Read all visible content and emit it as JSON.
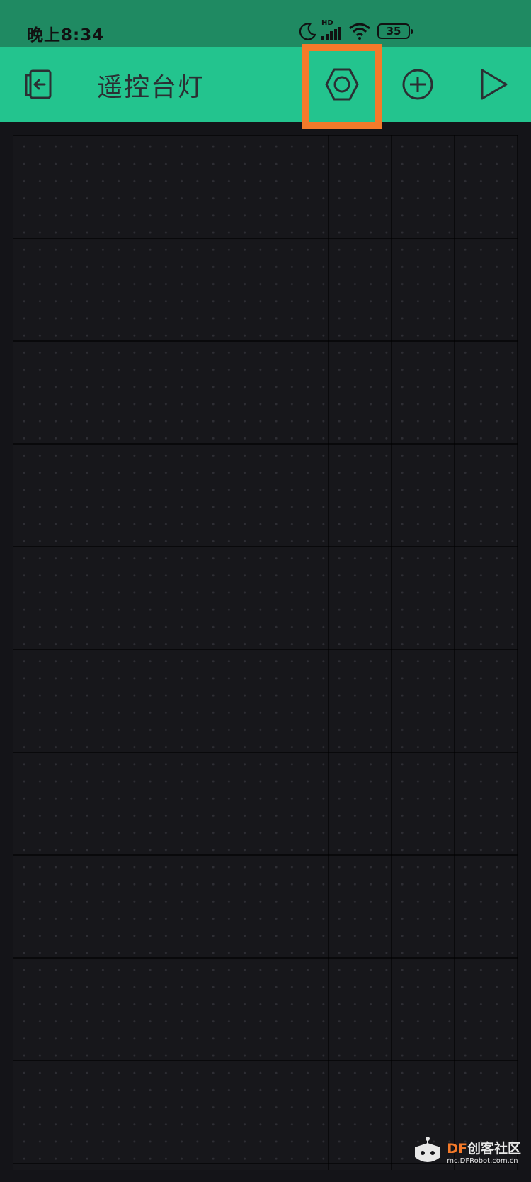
{
  "status_bar": {
    "time": "晚上8:34",
    "network_label": "HD",
    "battery_level": "35",
    "icons": [
      "moon-icon",
      "signal-icon",
      "wifi-icon",
      "battery-icon"
    ]
  },
  "appbar": {
    "title": "遥控台灯",
    "buttons": [
      "exit-icon",
      "settings-hexagon-icon",
      "add-widget-icon",
      "play-icon"
    ],
    "highlighted_button": "settings-hexagon-icon"
  },
  "colors": {
    "status_bar_bg": "#1f8a62",
    "appbar_bg": "#23c48e",
    "canvas_bg": "#17171b",
    "highlight": "#f47a2a"
  },
  "watermark": {
    "brand_prefix": "DF",
    "brand_name": "创客社区",
    "url": "mc.DFRobot.com.cn"
  }
}
